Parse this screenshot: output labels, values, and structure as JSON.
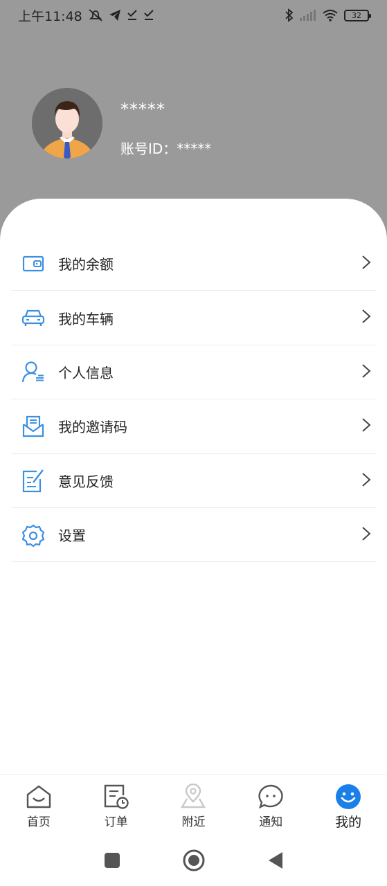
{
  "status_bar": {
    "time": "上午11:48",
    "battery": "32"
  },
  "profile": {
    "username": "*****",
    "account_id": "账号ID：*****"
  },
  "menu": [
    {
      "label": "我的余额",
      "icon": "wallet-icon"
    },
    {
      "label": "我的车辆",
      "icon": "car-icon"
    },
    {
      "label": "个人信息",
      "icon": "user-info-icon"
    },
    {
      "label": "我的邀请码",
      "icon": "invite-envelope-icon"
    },
    {
      "label": "意见反馈",
      "icon": "feedback-edit-icon"
    },
    {
      "label": "设置",
      "icon": "gear-icon"
    }
  ],
  "bottom_nav": [
    {
      "label": "首页",
      "icon": "home-icon"
    },
    {
      "label": "订单",
      "icon": "order-icon"
    },
    {
      "label": "附近",
      "icon": "location-icon"
    },
    {
      "label": "通知",
      "icon": "chat-icon"
    },
    {
      "label": "我的",
      "icon": "smiley-icon",
      "active": true
    }
  ],
  "colors": {
    "accent": "#3d8fe0",
    "active_tab": "#1a7fe8",
    "header_bg": "#9a9a9a"
  }
}
